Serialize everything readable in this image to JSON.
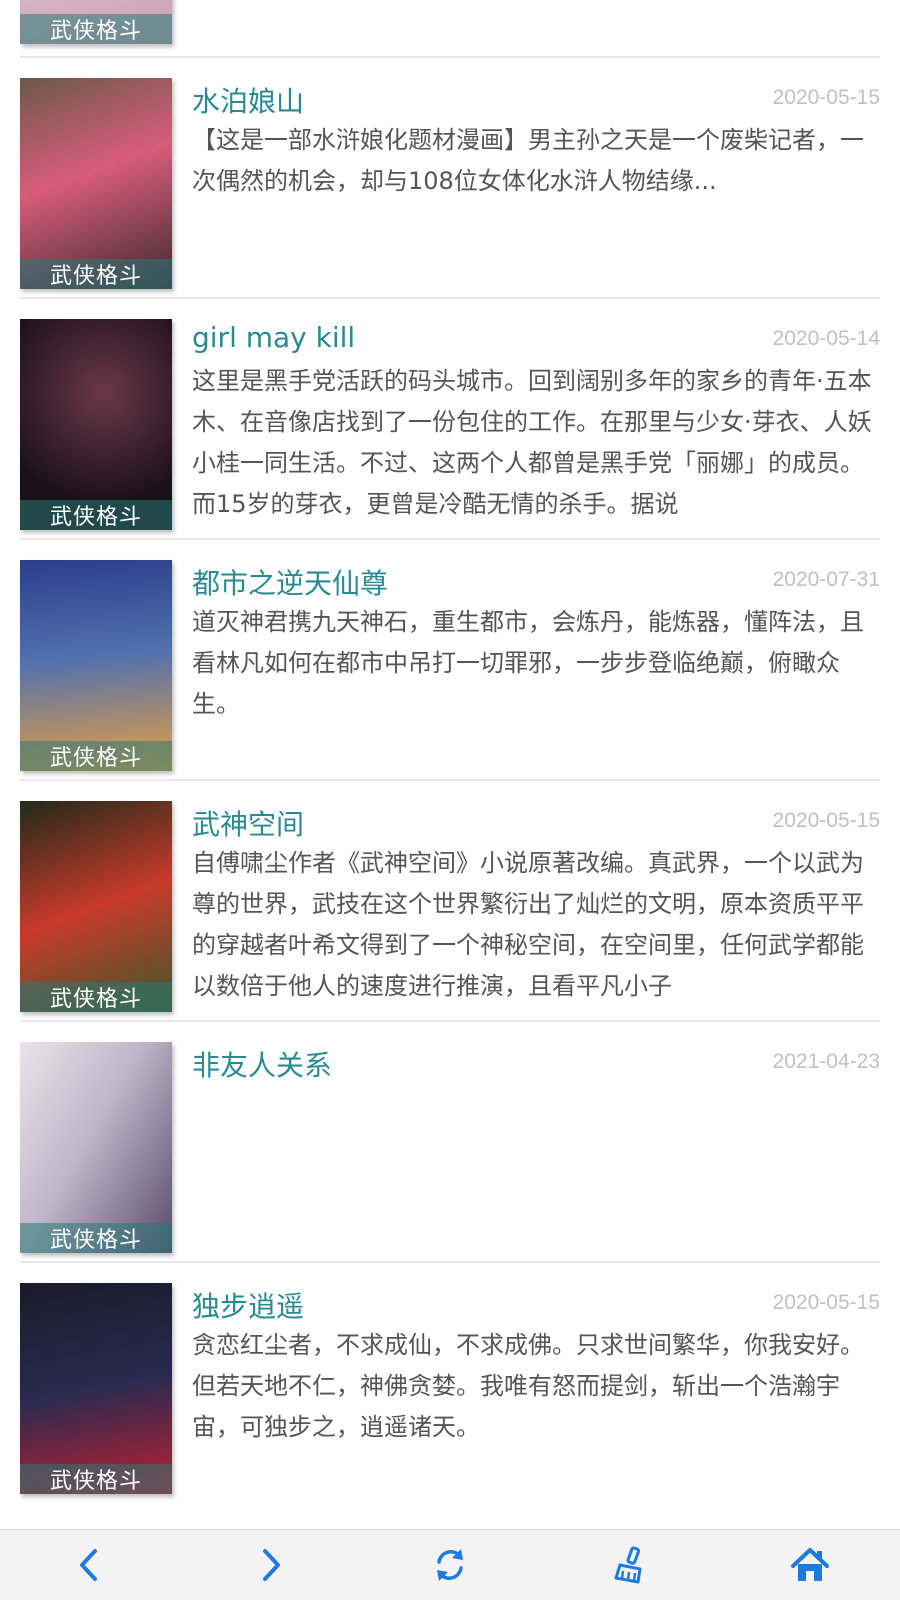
{
  "items": [
    {
      "title": "",
      "date": "",
      "desc": "",
      "tag": "武侠格斗",
      "colors": [
        "#f0d8e0",
        "#c9a0b0"
      ]
    },
    {
      "title": "水泊娘山",
      "date": "2020-05-15",
      "desc": "【这是一部水浒娘化题材漫画】男主孙之天是一个废柴记者，一次偶然的机会，却与108位女体化水浒人物结缘...",
      "tag": "武侠格斗",
      "colors": [
        "#d95c7a",
        "#3a2a30"
      ]
    },
    {
      "title": "girl may kill",
      "date": "2020-05-14",
      "desc": "这里是黑手党活跃的码头城市。回到阔别多年的家乡的青年·五本木、在音像店找到了一份包住的工作。在那里与少女·芽衣、人妖小桂一同生活。不过、这两个人都曾是黑手党「丽娜」的成员。而15岁的芽衣，更曾是冷酷无情的杀手。据说",
      "tag": "武侠格斗",
      "colors": [
        "#1a1018",
        "#6a3848"
      ]
    },
    {
      "title": "都市之逆天仙尊",
      "date": "2020-07-31",
      "desc": "道灭神君携九天神石，重生都市，会炼丹，能炼器，懂阵法，且看林凡如何在都市中吊打一切罪邪，一步步登临绝巅，俯瞰众生。",
      "tag": "武侠格斗",
      "colors": [
        "#2a3f8a",
        "#e8a040"
      ]
    },
    {
      "title": "武神空间",
      "date": "2020-05-15",
      "desc": "自傅啸尘作者《武神空间》小说原著改编。真武界，一个以武为尊的世界，武技在这个世界繁衍出了灿烂的文明，原本资质平平的穿越者叶希文得到了一个神秘空间，在空间里，任何武学都能以数倍于他人的速度进行推演，且看平凡小子",
      "tag": "武侠格斗",
      "colors": [
        "#1f2a1a",
        "#c83a2a"
      ]
    },
    {
      "title": "非友人关系",
      "date": "2021-04-23",
      "desc": "",
      "tag": "武侠格斗",
      "colors": [
        "#e8e4ea",
        "#5a4a6a"
      ]
    },
    {
      "title": "独步逍遥",
      "date": "2020-05-15",
      "desc": "贪恋红尘者，不求成仙，不求成佛。只求世间繁华，你我安好。但若天地不仁，神佛贪婪。我唯有怒而提剑，斩出一个浩瀚宇宙，可独步之，逍遥诸天。",
      "tag": "武侠格斗",
      "colors": [
        "#1a1a2a",
        "#c02030"
      ]
    }
  ],
  "toolbar": {
    "accent": "#1f7ae0",
    "buttons": [
      {
        "name": "back-button",
        "icon": "chevron-left-icon"
      },
      {
        "name": "forward-button",
        "icon": "chevron-right-icon"
      },
      {
        "name": "refresh-button",
        "icon": "refresh-icon"
      },
      {
        "name": "clean-button",
        "icon": "brush-icon"
      },
      {
        "name": "home-button",
        "icon": "home-icon"
      }
    ]
  }
}
